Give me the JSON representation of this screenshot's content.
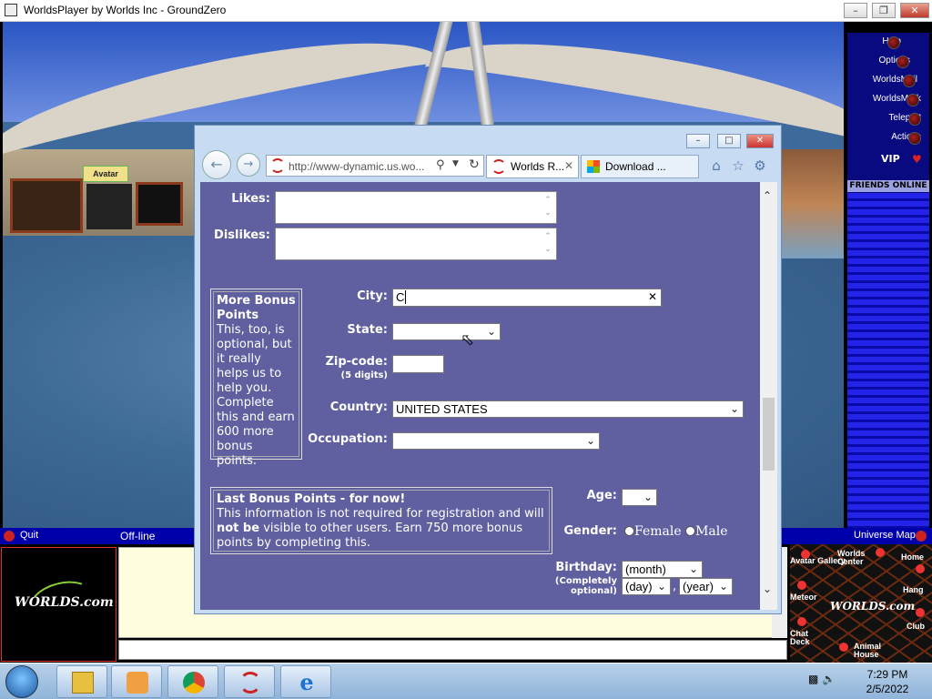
{
  "window": {
    "title": "WorldsPlayer by Worlds Inc - GroundZero"
  },
  "world": {
    "gallery_sign": "Avatar Gallery"
  },
  "right_panel": {
    "items": [
      "Help",
      "Options",
      "WorldsMail",
      "WorldsMark",
      "Teleport",
      "Actions"
    ],
    "vip": "VIP",
    "friends": "FRIENDS ONLINE"
  },
  "status": {
    "quit": "Quit",
    "offline": "Off-line",
    "universe_map": "Universe Map"
  },
  "logo": {
    "text": "WORLDS.com"
  },
  "map": {
    "labels": [
      "Avatar Gallery",
      "Worlds Center",
      "Home",
      "Hang",
      "Meteor",
      "Club",
      "Chat Deck",
      "Animal House"
    ],
    "center": "WORLDS.com"
  },
  "browser": {
    "url": "http://www-dynamic.us.wo...",
    "tabs": [
      {
        "label": "Worlds R...",
        "active": true
      },
      {
        "label": "Download ...",
        "active": false
      }
    ]
  },
  "form": {
    "likes_label": "Likes:",
    "dislikes_label": "Dislikes:",
    "city_label": "City:",
    "city_value": "C",
    "state_label": "State:",
    "state_value": "",
    "zip_label": "Zip-code:",
    "zip_hint": "(5 digits)",
    "country_label": "Country:",
    "country_value": "UNITED STATES",
    "occupation_label": "Occupation:",
    "occupation_value": "",
    "age_label": "Age:",
    "gender_label": "Gender:",
    "gender_female": "Female",
    "gender_male": "Male",
    "birthday_label": "Birthday:",
    "birthday_hint1": "(Completely",
    "birthday_hint2": "optional)",
    "month": "(month)",
    "day": "(day)",
    "year": "(year)",
    "sep": ","
  },
  "more_bonus": {
    "title": "More Bonus Points",
    "body": "This, too, is optional, but it really helps us to help you. Complete this and earn 600 more bonus points."
  },
  "last_bonus": {
    "title": "Last Bonus Points - for now!",
    "body1": "This information is not required for registration and will ",
    "bold": "not be",
    "body2": " visible to other users. Earn 750 more bonus points by completing this."
  },
  "taskbar": {
    "time": "7:29 PM",
    "date": "2/5/2022"
  },
  "colors": {
    "form_bg": "#6060a0",
    "panel_blue": "#2424e8",
    "status_blue": "#0000aa"
  }
}
